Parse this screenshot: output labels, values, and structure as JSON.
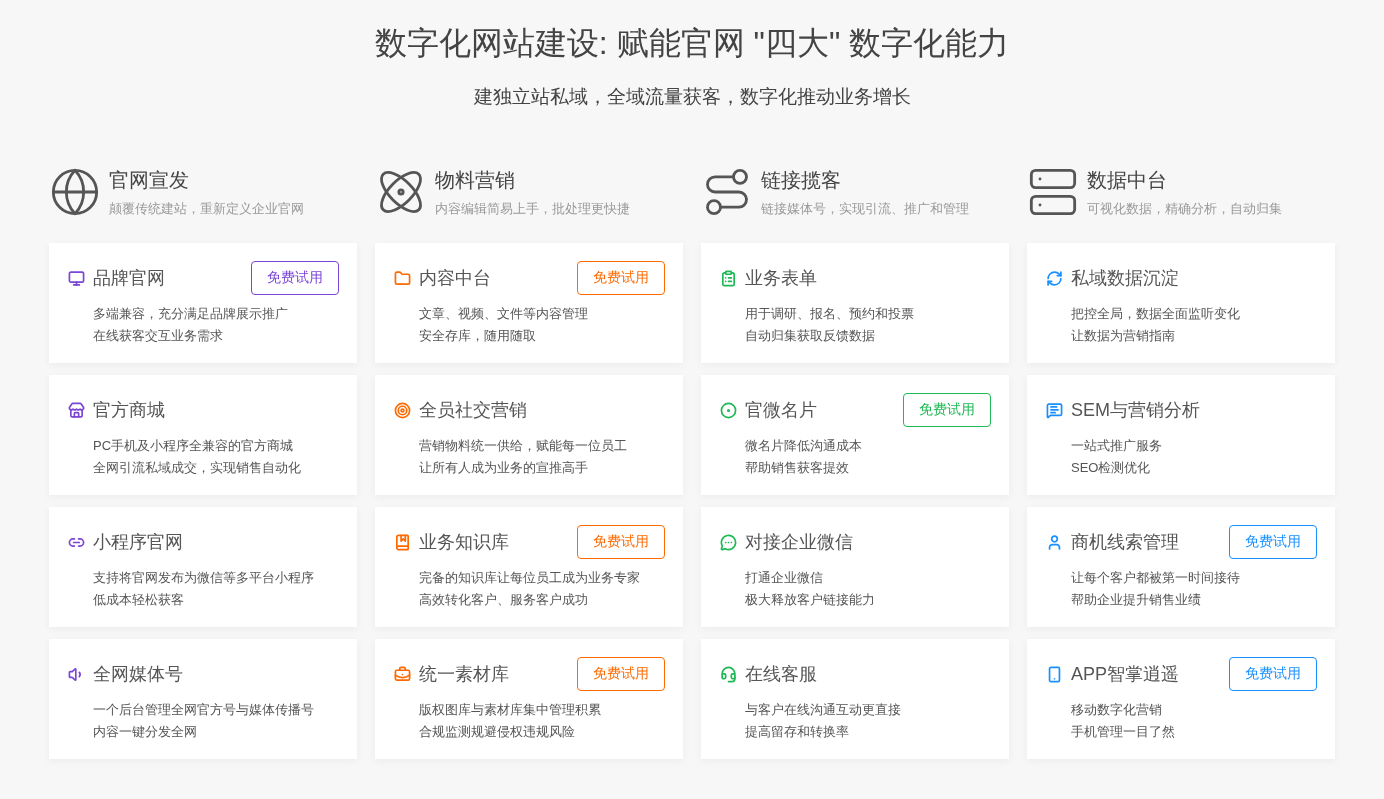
{
  "title": "数字化网站建设: 赋能官网 \"四大\" 数字化能力",
  "subtitle": "建独立站私域，全域流量获客，数字化推动业务增长",
  "columns": [
    {
      "title": "官网宣发",
      "desc": "颠覆传统建站，重新定义企业官网",
      "color": "#7b45d6",
      "cards": [
        {
          "title": "品牌官网",
          "lines": [
            "多端兼容，充分满足品牌展示推广",
            "在线获客交互业务需求"
          ],
          "button": "免费试用"
        },
        {
          "title": "官方商城",
          "lines": [
            "PC手机及小程序全兼容的官方商城",
            "全网引流私域成交，实现销售自动化"
          ]
        },
        {
          "title": "小程序官网",
          "lines": [
            "支持将官网发布为微信等多平台小程序",
            "低成本轻松获客"
          ]
        },
        {
          "title": "全网媒体号",
          "lines": [
            "一个后台管理全网官方号与媒体传播号",
            "内容一键分发全网"
          ]
        }
      ]
    },
    {
      "title": "物料营销",
      "desc": "内容编辑简易上手，批处理更快捷",
      "color": "#ff6a00",
      "cards": [
        {
          "title": "内容中台",
          "lines": [
            "文章、视频、文件等内容管理",
            "安全存库，随用随取"
          ],
          "button": "免费试用"
        },
        {
          "title": "全员社交营销",
          "lines": [
            "营销物料统一供给，赋能每一位员工",
            "让所有人成为业务的宣推高手"
          ]
        },
        {
          "title": "业务知识库",
          "lines": [
            "完备的知识库让每位员工成为业务专家",
            "高效转化客户、服务客户成功"
          ],
          "button": "免费试用"
        },
        {
          "title": "统一素材库",
          "lines": [
            "版权图库与素材库集中管理积累",
            "合规监测规避侵权违规风险"
          ],
          "button": "免费试用"
        }
      ]
    },
    {
      "title": "链接揽客",
      "desc": "链接媒体号，实现引流、推广和管理",
      "color": "#1db954",
      "cards": [
        {
          "title": "业务表单",
          "lines": [
            "用于调研、报名、预约和投票",
            "自动归集获取反馈数据"
          ]
        },
        {
          "title": "官微名片",
          "lines": [
            "微名片降低沟通成本",
            "帮助销售获客提效"
          ],
          "button": "免费试用"
        },
        {
          "title": "对接企业微信",
          "lines": [
            "打通企业微信",
            "极大释放客户链接能力"
          ]
        },
        {
          "title": "在线客服",
          "lines": [
            "与客户在线沟通互动更直接",
            "提高留存和转换率"
          ]
        }
      ]
    },
    {
      "title": "数据中台",
      "desc": "可视化数据，精确分析，自动归集",
      "color": "#1890ff",
      "cards": [
        {
          "title": "私域数据沉淀",
          "lines": [
            "把控全局，数据全面监听变化",
            "让数据为营销指南"
          ]
        },
        {
          "title": "SEM与营销分析",
          "lines": [
            "一站式推广服务",
            "SEO检测优化"
          ]
        },
        {
          "title": "商机线索管理",
          "lines": [
            "让每个客户都被第一时间接待",
            "帮助企业提升销售业绩"
          ],
          "button": "免费试用"
        },
        {
          "title": "APP智掌逍遥",
          "lines": [
            "移动数字化营销",
            "手机管理一目了然"
          ],
          "button": "免费试用"
        }
      ]
    }
  ]
}
